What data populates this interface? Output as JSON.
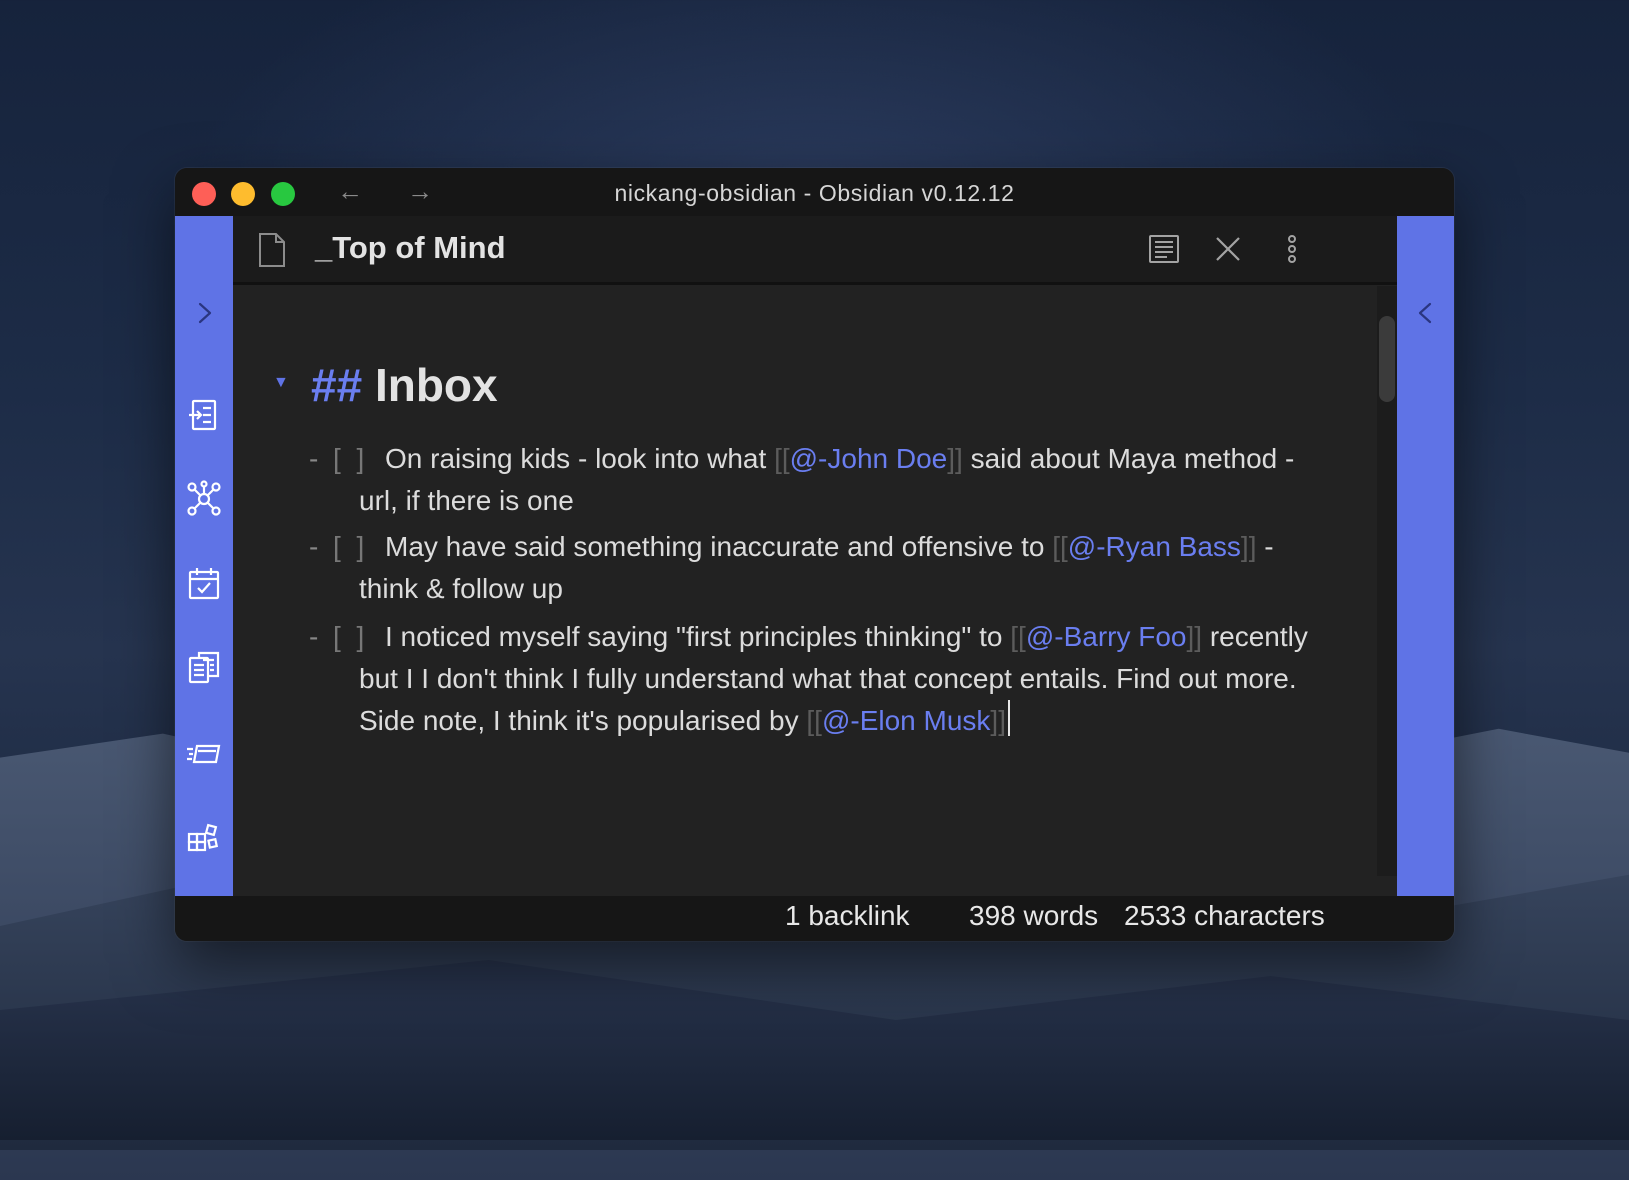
{
  "window": {
    "title": "nickang-obsidian - Obsidian v0.12.12"
  },
  "nav": {
    "back": "←",
    "forward": "→"
  },
  "ribbon": {
    "left_icons": [
      "sidebar-expand-icon",
      "import-note-icon",
      "graph-view-icon",
      "daily-note-calendar-icon",
      "templates-icon",
      "slides-icon",
      "kanban-grid-icon"
    ],
    "right_icons": [
      "sidebar-expand-icon"
    ]
  },
  "view": {
    "title": "_Top of Mind"
  },
  "editor": {
    "heading_marker": "##",
    "heading_text": "Inbox",
    "tasks": [
      {
        "checkbox": "[ ]",
        "parts": [
          {
            "t": "On raising kids - look into what ",
            "k": "text"
          },
          {
            "t": "[[",
            "k": "br"
          },
          {
            "t": "@-John Doe",
            "k": "link"
          },
          {
            "t": "]]",
            "k": "br"
          },
          {
            "t": " said about Maya method - url, if there is one",
            "k": "text"
          }
        ]
      },
      {
        "checkbox": "[ ]",
        "parts": [
          {
            "t": "May have said something inaccurate and offensive to ",
            "k": "text"
          },
          {
            "t": "[[",
            "k": "br"
          },
          {
            "t": "@-Ryan Bass",
            "k": "link"
          },
          {
            "t": "]]",
            "k": "br"
          },
          {
            "t": " - think & follow up",
            "k": "text"
          }
        ]
      },
      {
        "checkbox": "[ ]",
        "parts": [
          {
            "t": "I noticed myself saying \"first principles thinking\" to ",
            "k": "text"
          },
          {
            "t": "[[",
            "k": "br"
          },
          {
            "t": "@-Barry Foo",
            "k": "link"
          },
          {
            "t": "]]",
            "k": "br"
          },
          {
            "t": " recently but I I don't think I fully understand what that concept entails. Find out more. Side note, I think it's popularised by ",
            "k": "text"
          },
          {
            "t": "[[",
            "k": "br"
          },
          {
            "t": "@-Elon Musk",
            "k": "link"
          },
          {
            "t": "]]",
            "k": "br"
          }
        ]
      }
    ]
  },
  "status": {
    "backlinks": "1 backlink",
    "words": "398 words",
    "characters": "2533 characters"
  },
  "colors": {
    "accent": "#5f73e6",
    "link": "#6a7ef0",
    "background": "#222222"
  }
}
